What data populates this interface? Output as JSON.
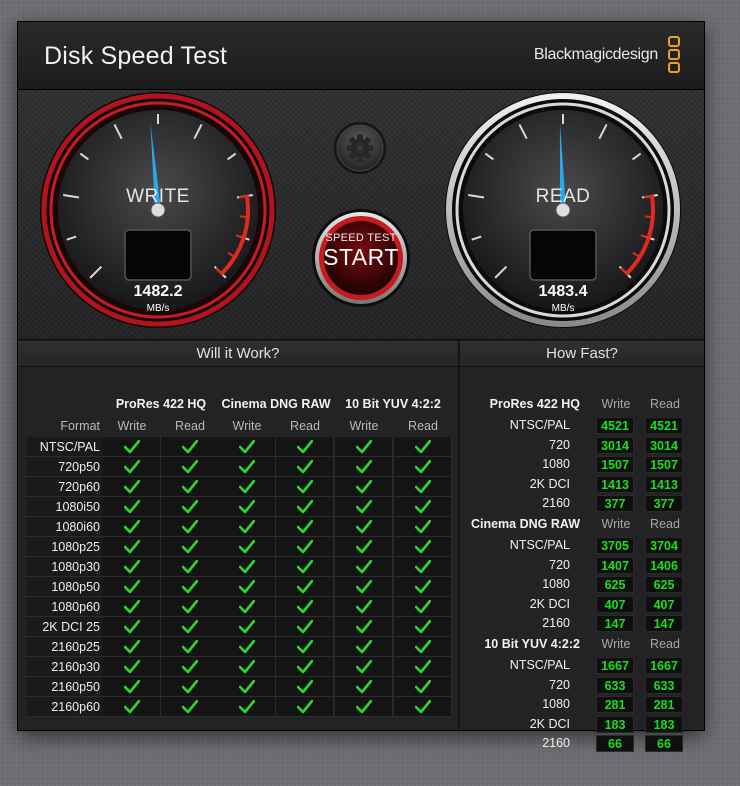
{
  "app": {
    "title": "Disk Speed Test",
    "brand": "Blackmagicdesign",
    "close_glyph": "×"
  },
  "gauges": {
    "write": {
      "label": "WRITE",
      "value": "1482.2",
      "unit": "MB/s"
    },
    "read": {
      "label": "READ",
      "value": "1483.4",
      "unit": "MB/s"
    }
  },
  "start_button": {
    "small_label": "SPEED TEST",
    "big_label": "START"
  },
  "will_it_work": {
    "title": "Will it Work?",
    "format_header": "Format",
    "groups": [
      "ProRes 422 HQ",
      "Cinema DNG RAW",
      "10 Bit YUV 4:2:2"
    ],
    "sub_headers": [
      "Write",
      "Read"
    ],
    "rows": [
      "NTSC/PAL",
      "720p50",
      "720p60",
      "1080i50",
      "1080i60",
      "1080p25",
      "1080p30",
      "1080p50",
      "1080p60",
      "2K DCI 25",
      "2160p25",
      "2160p30",
      "2160p50",
      "2160p60"
    ],
    "all_supported": true
  },
  "how_fast": {
    "title": "How Fast?",
    "sub_headers": [
      "Write",
      "Read"
    ],
    "groups": [
      {
        "name": "ProRes 422 HQ",
        "rows": [
          {
            "label": "NTSC/PAL",
            "write": "4521",
            "read": "4521"
          },
          {
            "label": "720",
            "write": "3014",
            "read": "3014"
          },
          {
            "label": "1080",
            "write": "1507",
            "read": "1507"
          },
          {
            "label": "2K DCI",
            "write": "1413",
            "read": "1413"
          },
          {
            "label": "2160",
            "write": "377",
            "read": "377"
          }
        ]
      },
      {
        "name": "Cinema DNG RAW",
        "rows": [
          {
            "label": "NTSC/PAL",
            "write": "3705",
            "read": "3704"
          },
          {
            "label": "720",
            "write": "1407",
            "read": "1406"
          },
          {
            "label": "1080",
            "write": "625",
            "read": "625"
          },
          {
            "label": "2K DCI",
            "write": "407",
            "read": "407"
          },
          {
            "label": "2160",
            "write": "147",
            "read": "147"
          }
        ]
      },
      {
        "name": "10 Bit YUV 4:2:2",
        "rows": [
          {
            "label": "NTSC/PAL",
            "write": "1667",
            "read": "1667"
          },
          {
            "label": "720",
            "write": "633",
            "read": "633"
          },
          {
            "label": "1080",
            "write": "281",
            "read": "281"
          },
          {
            "label": "2K DCI",
            "write": "183",
            "read": "183"
          },
          {
            "label": "2160",
            "write": "66",
            "read": "66"
          }
        ]
      }
    ]
  },
  "colors": {
    "accent_green": "#19e019",
    "write_ring": "#b3141b",
    "brand_orange": "#f0a020",
    "needle": "#27a9f0"
  }
}
